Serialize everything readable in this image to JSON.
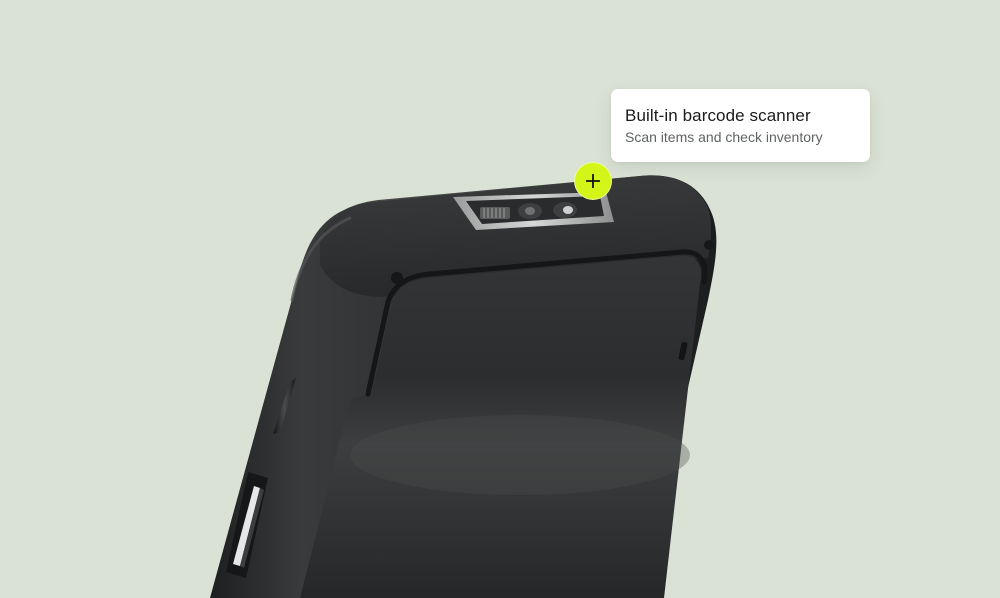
{
  "tooltip": {
    "title": "Built-in barcode scanner",
    "subtitle": "Scan items and check inventory"
  },
  "hotspot": {
    "icon": "plus-icon",
    "color": "#d4f518"
  },
  "colors": {
    "background": "#dae2d5",
    "device_body": "#2b2c2d",
    "accent": "#d4f518"
  }
}
